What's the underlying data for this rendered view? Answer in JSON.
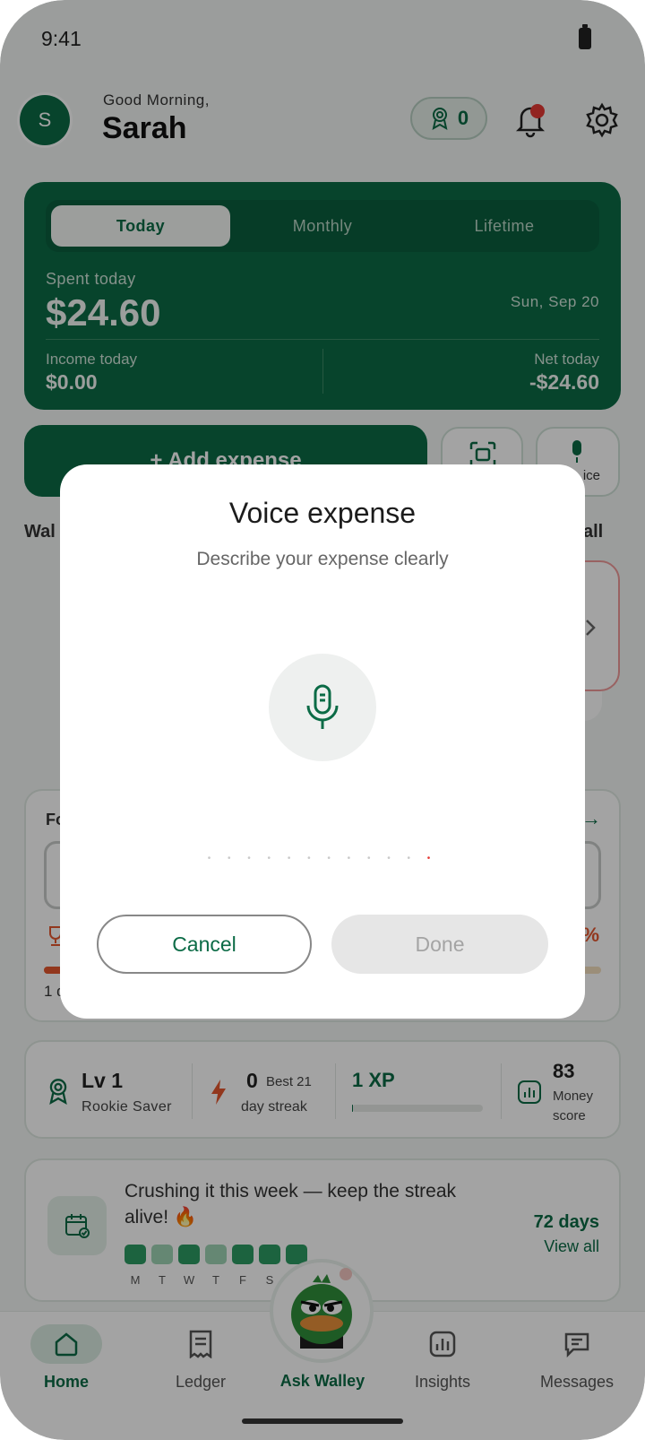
{
  "status_bar": {
    "time": "9:41"
  },
  "header": {
    "avatar_initial": "S",
    "greeting": "Good Morning,",
    "name": "Sarah",
    "reward_count": "0"
  },
  "spend_card": {
    "tabs": [
      "Today",
      "Monthly",
      "Lifetime"
    ],
    "active_tab": "Today",
    "spent_label": "Spent today",
    "spent_value": "$24.60",
    "date": "Sun, Sep 20",
    "income_label": "Income today",
    "income_value": "$0.00",
    "net_label": "Net today",
    "net_value": "-$24.60"
  },
  "actions": {
    "add_expense": "+ Add expense",
    "voice_partial": "ice"
  },
  "wallets": {
    "title_partial": "Wal",
    "see_all_partial": "all"
  },
  "focus": {
    "title_partial": "Fo",
    "arrow": "→",
    "percent_partial": "%",
    "sub_partial": "1 d",
    "progress_fraction": 0.04
  },
  "stats": {
    "level": "Lv 1",
    "level_name": "Rookie Saver",
    "streak": "0",
    "streak_best": "Best 21",
    "streak_unit": "day streak",
    "xp": "1 XP",
    "xp_progress_fraction": 0.01,
    "money_score": "83",
    "money_score_label": "Money score"
  },
  "week": {
    "message": "Crushing it this week — keep the streak alive! 🔥",
    "days": [
      "M",
      "T",
      "W",
      "T",
      "F",
      "S"
    ],
    "day_states": [
      "full",
      "light",
      "full",
      "light",
      "full",
      "full",
      "full"
    ],
    "streak_days": "72 days",
    "view_all": "View all"
  },
  "bottom_nav": {
    "items": [
      {
        "label": "Home",
        "icon": "home-icon",
        "active": true
      },
      {
        "label": "Ledger",
        "icon": "receipt-icon",
        "active": false
      },
      {
        "label": "Ask Walley",
        "icon": "walley-mascot",
        "active": false
      },
      {
        "label": "Insights",
        "icon": "bar-chart-icon",
        "active": false
      },
      {
        "label": "Messages",
        "icon": "message-icon",
        "active": false
      }
    ]
  },
  "modal": {
    "title": "Voice expense",
    "subtitle": "Describe your expense clearly",
    "cancel": "Cancel",
    "done": "Done"
  },
  "colors": {
    "brand": "#0b6b46",
    "alert": "#e53935",
    "accent_orange": "#e4572e"
  }
}
